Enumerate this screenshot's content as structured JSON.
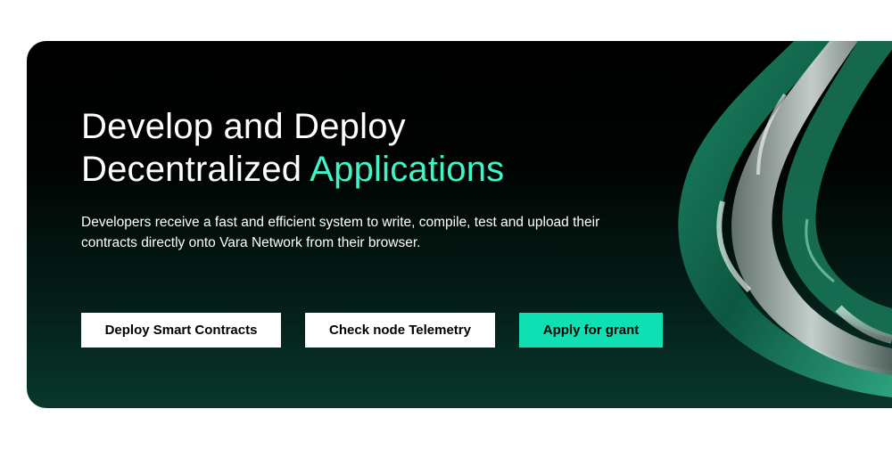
{
  "hero": {
    "title_line1": "Develop and Deploy",
    "title_line2_plain": "Decentralized ",
    "title_line2_accent": "Applications",
    "description": "Developers receive a fast and efficient system to write, compile, test and upload their contracts directly onto Vara Network from their browser."
  },
  "actions": {
    "deploy_label": "Deploy Smart Contracts",
    "telemetry_label": "Check node Telemetry",
    "grant_label": "Apply for grant"
  },
  "colors": {
    "accent": "#3ff5c8",
    "grant_button": "#0fe0b3",
    "hero_gradient_top": "#000000",
    "hero_gradient_bottom": "#08382c"
  }
}
